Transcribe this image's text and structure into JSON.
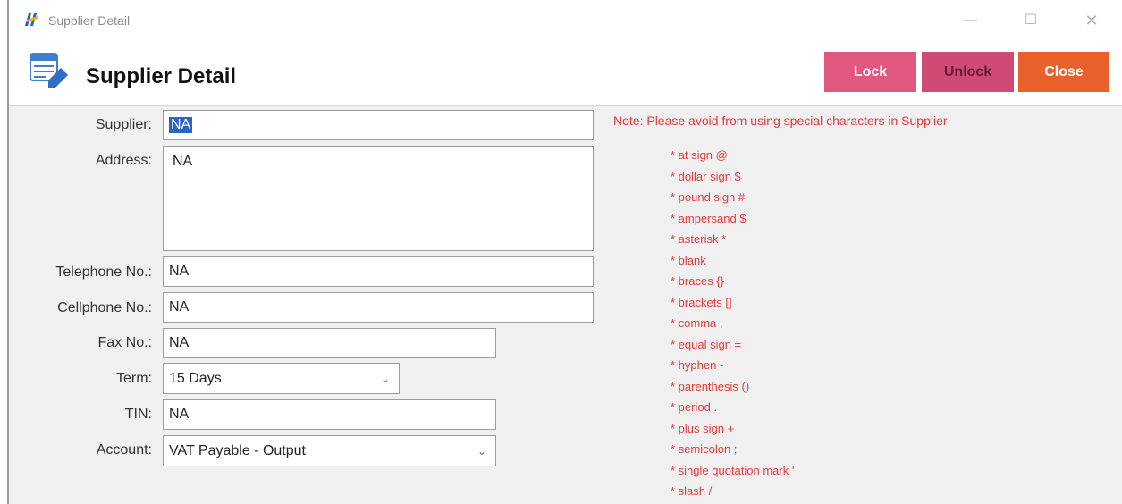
{
  "window": {
    "title": "Supplier Detail",
    "controls": {
      "minimize": "—",
      "maximize": "☐",
      "close": "✕"
    }
  },
  "header": {
    "title": "Supplier Detail",
    "buttons": {
      "lock": "Lock",
      "unlock": "Unlock",
      "close": "Close"
    }
  },
  "form": {
    "supplier": {
      "label": "Supplier:",
      "value": "NA"
    },
    "address": {
      "label": "Address:",
      "value": "NA"
    },
    "telephone": {
      "label": "Telephone No.:",
      "value": "NA"
    },
    "cellphone": {
      "label": "Cellphone No.:",
      "value": "NA"
    },
    "fax": {
      "label": "Fax No.:",
      "value": "NA"
    },
    "term": {
      "label": "Term:",
      "value": "15 Days"
    },
    "tin": {
      "label": "TIN:",
      "value": "NA"
    },
    "account": {
      "label": "Account:",
      "value": "VAT Payable - Output"
    }
  },
  "note": {
    "text": "Note: Please avoid from using special characters in Supplier",
    "items": [
      "* at sign @",
      "* dollar sign $",
      "* pound sign #",
      "* ampersand $",
      "* asterisk *",
      "* blank",
      "* braces {}",
      "* brackets []",
      "* comma ,",
      "* equal sign =",
      "* hyphen -",
      "* parenthesis ()",
      "* period .",
      "* plus sign +",
      "* semicolon ;",
      "* single quotation mark '",
      "* slash /"
    ]
  },
  "colors": {
    "lock": "#e0577f",
    "unlock": "#cf4a74",
    "close": "#e8602a",
    "note_text": "#e23a3a",
    "selection": "#2b63c6"
  }
}
